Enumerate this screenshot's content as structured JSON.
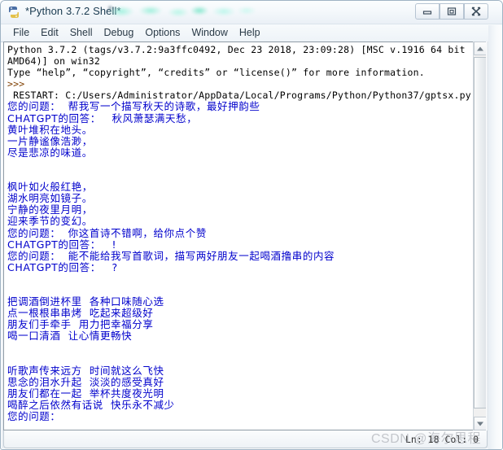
{
  "window": {
    "title": "*Python 3.7.2 Shell*",
    "redacted_suffix": "*",
    "icon": "python-idle-icon",
    "controls": {
      "minimize": "minimize-button",
      "maximize": "restore-button",
      "close": "close-button"
    }
  },
  "menubar": {
    "items": [
      {
        "label": "File"
      },
      {
        "label": "Edit"
      },
      {
        "label": "Shell"
      },
      {
        "label": "Debug"
      },
      {
        "label": "Options"
      },
      {
        "label": "Window"
      },
      {
        "label": "Help"
      }
    ]
  },
  "shell": {
    "lines": [
      {
        "text": "Python 3.7.2 (tags/v3.7.2:9a3ffc0492, Dec 23 2018, 23:09:28) [MSC v.1916 64 bit (",
        "color": "black",
        "cjk": false
      },
      {
        "text": "AMD64)] on win32",
        "color": "black",
        "cjk": false
      },
      {
        "text": "Type “help”, “copyright”, “credits” or “license()” for more information.",
        "color": "black",
        "cjk": false
      },
      {
        "text": ">>>",
        "color": "brown",
        "cjk": false
      },
      {
        "text": " RESTART: C:/Users/Administrator/AppData/Local/Programs/Python/Python37/gptsx.py",
        "color": "black",
        "cjk": false
      },
      {
        "text": "您的问题：  帮我写一个描写秋天的诗歌，最好押韵些",
        "color": "blue",
        "cjk": true
      },
      {
        "text": "CHATGPT的回答：   秋风萧瑟满天愁，",
        "color": "blue",
        "cjk": true
      },
      {
        "text": "黄叶堆积在地头。",
        "color": "blue",
        "cjk": true
      },
      {
        "text": "一片静谧像浩渺，",
        "color": "blue",
        "cjk": true
      },
      {
        "text": "尽是悲凉的味道。",
        "color": "blue",
        "cjk": true
      },
      {
        "text": "",
        "color": "blue",
        "cjk": true
      },
      {
        "text": "",
        "color": "blue",
        "cjk": true
      },
      {
        "text": "枫叶如火般红艳，",
        "color": "blue",
        "cjk": true
      },
      {
        "text": "湖水明亮如镜子。",
        "color": "blue",
        "cjk": true
      },
      {
        "text": "宁静的夜里月明，",
        "color": "blue",
        "cjk": true
      },
      {
        "text": "迎来季节的变幻。",
        "color": "blue",
        "cjk": true
      },
      {
        "text": "您的问题：  你这首诗不错啊，给你点个赞",
        "color": "blue",
        "cjk": true
      },
      {
        "text": "CHATGPT的回答：   !",
        "color": "blue",
        "cjk": true
      },
      {
        "text": "您的问题：  能不能给我写首歌词，描写两好朋友一起喝酒撸串的内容",
        "color": "blue",
        "cjk": true
      },
      {
        "text": "CHATGPT的回答：   ?",
        "color": "blue",
        "cjk": true
      },
      {
        "text": "",
        "color": "blue",
        "cjk": true
      },
      {
        "text": "",
        "color": "blue",
        "cjk": true
      },
      {
        "text": "把调酒倒进杯里  各种口味随心选",
        "color": "blue",
        "cjk": true
      },
      {
        "text": "点一根根串串烤  吃起来超级好",
        "color": "blue",
        "cjk": true
      },
      {
        "text": "朋友们手牵手  用力把幸福分享",
        "color": "blue",
        "cjk": true
      },
      {
        "text": "喝一口清酒  让心情更畅快",
        "color": "blue",
        "cjk": true
      },
      {
        "text": "",
        "color": "blue",
        "cjk": true
      },
      {
        "text": "",
        "color": "blue",
        "cjk": true
      },
      {
        "text": "听歌声传来远方  时间就这么飞快",
        "color": "blue",
        "cjk": true
      },
      {
        "text": "思念的泪水升起  淡淡的感受真好",
        "color": "blue",
        "cjk": true
      },
      {
        "text": "朋友们都在一起  举杯共度夜光明",
        "color": "blue",
        "cjk": true
      },
      {
        "text": "喝醉之后依然有话说  快乐永不减少",
        "color": "blue",
        "cjk": true
      },
      {
        "text": "您的问题：",
        "color": "blue",
        "cjk": true
      }
    ]
  },
  "statusbar": {
    "position": "Ln: 18  Col: 0"
  },
  "watermark": {
    "prefix": "CSDN @",
    "author": "海尔思程"
  },
  "colors": {
    "output_blue": "#0000cc",
    "prompt_brown": "#7f3f00",
    "text_black": "#000000",
    "title_text": "#18394f",
    "redaction_green": "#8cf0d7"
  }
}
